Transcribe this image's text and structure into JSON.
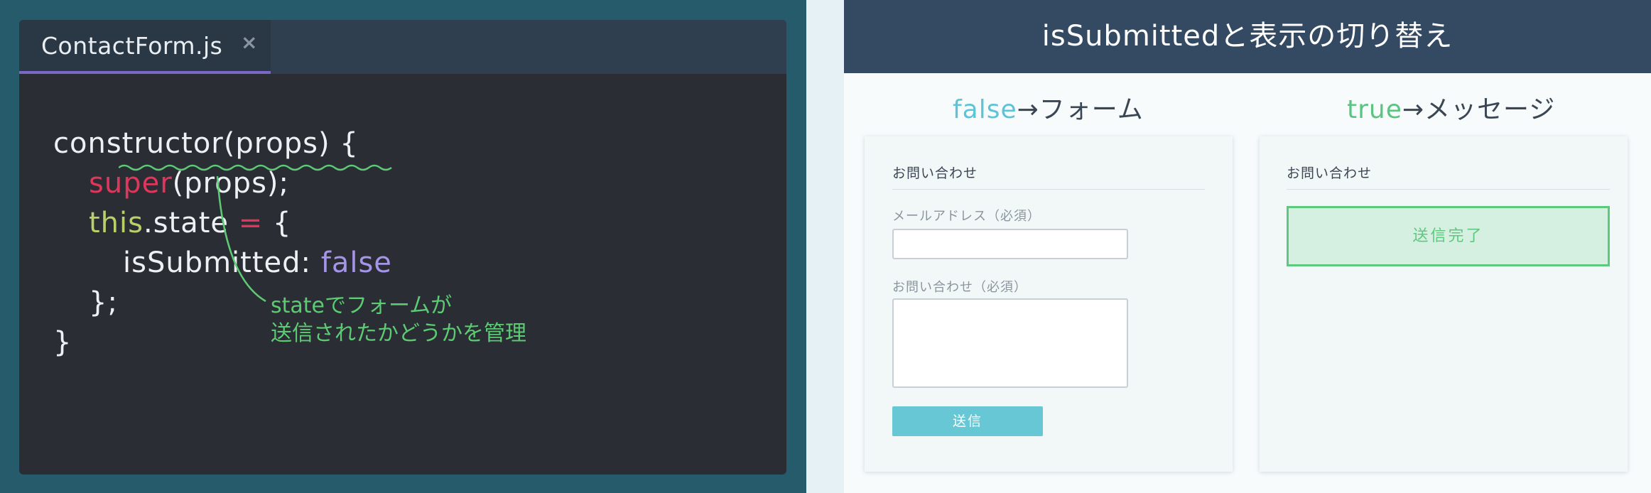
{
  "editor": {
    "tab_title": "ContactForm.js",
    "tab_close": "×",
    "code": {
      "line1": "constructor(props) {",
      "line2_kw": "super",
      "line2_rest": "(props);",
      "line3_kw": "this",
      "line3_mid": ".state ",
      "line3_op": "=",
      "line3_end": " {",
      "line4_key": "isSubmitted: ",
      "line4_val": "false",
      "line5": "};",
      "line6": "}"
    },
    "annotation": {
      "line1": "stateでフォームが",
      "line2": "送信されたかどうかを管理"
    }
  },
  "slide": {
    "title": "isSubmittedと表示の切り替え",
    "left_column": {
      "highlight": "false",
      "rest": "→フォーム"
    },
    "right_column": {
      "highlight": "true",
      "rest": "→メッセージ"
    },
    "form_card": {
      "title": "お問い合わせ",
      "email_label": "メールアドレス（必須）",
      "message_label": "お問い合わせ（必須）",
      "submit_label": "送信"
    },
    "message_card": {
      "title": "お問い合わせ",
      "done_message": "送信完了"
    }
  },
  "colors": {
    "outer_background": "#265b6b",
    "editor_background": "#2a2d33",
    "tab_underline": "#7a67c7",
    "keyword_super": "#e0365c",
    "keyword_this": "#b9d068",
    "value_false": "#a595e8",
    "annotation_green": "#5ccb74",
    "slide_header": "#344a63",
    "accent_false": "#5cc4d6",
    "accent_true": "#5ac481",
    "submit_button": "#67c7d4",
    "done_box_bg": "#d5efe0"
  }
}
